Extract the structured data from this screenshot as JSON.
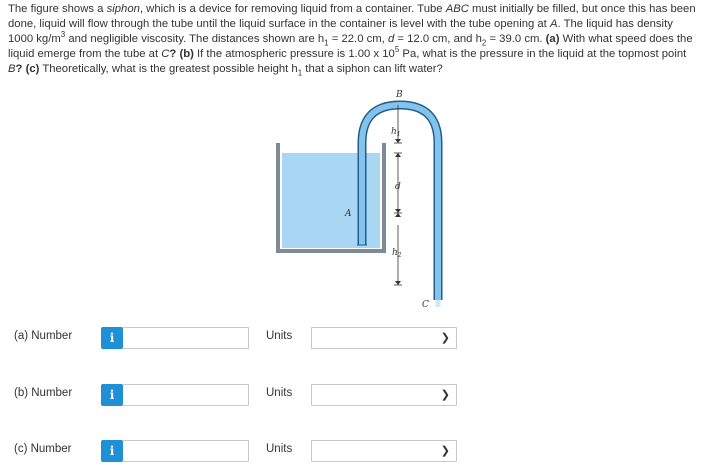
{
  "problem": {
    "intro": "The figure shows a ",
    "siphon_word": "siphon",
    "part1": ", which is a device for removing liquid from a container. Tube ",
    "tube_name": "ABC",
    "part2": " must initially be filled, but once this has been done, liquid will flow through the tube until the liquid surface in the container is level with the tube opening at ",
    "point_a": "A",
    "part3": ". The liquid has density 1000 kg/m",
    "cube_exp": "3",
    "part4": " and negligible viscosity. The distances shown are h",
    "sub1": "1",
    "part5": " = 22.0 cm, ",
    "d_var": "d",
    "part6": " = 12.0 cm, and h",
    "sub2": "2",
    "part7": " = 39.0 cm. ",
    "qa_label": "(a)",
    "qa_text": " With what speed does the liquid emerge from the tube at ",
    "point_c": "C",
    "qb_label": "? (b)",
    "qb_text": " If the atmospheric pressure is 1.00 x 10",
    "pow_exp": "5",
    "qb_text2": " Pa, what is the pressure in the liquid at the topmost point ",
    "point_b": "B",
    "qc_label": "? (c)",
    "qc_text": " Theoretically, what is the greatest possible height h",
    "sub3": "1",
    "qc_text2": " that a siphon can lift water?"
  },
  "figure": {
    "label_b": "B",
    "label_h1": "h",
    "label_h1_sub": "1",
    "label_d": "d",
    "label_a": "A",
    "label_h2": "h",
    "label_h2_sub": "2",
    "label_c": "C",
    "colors": {
      "water": "#a9d6f2",
      "tube": "#86c3ea",
      "tube_outline": "#1e5f8f",
      "container": "#7e8b96"
    }
  },
  "answers": [
    {
      "label": "(a)  Number",
      "info": "i",
      "units_label": "Units"
    },
    {
      "label": "(b)  Number",
      "info": "i",
      "units_label": "Units"
    },
    {
      "label": "(c)  Number",
      "info": "i",
      "units_label": "Units"
    }
  ],
  "select_chevron": "chevron-down-icon"
}
